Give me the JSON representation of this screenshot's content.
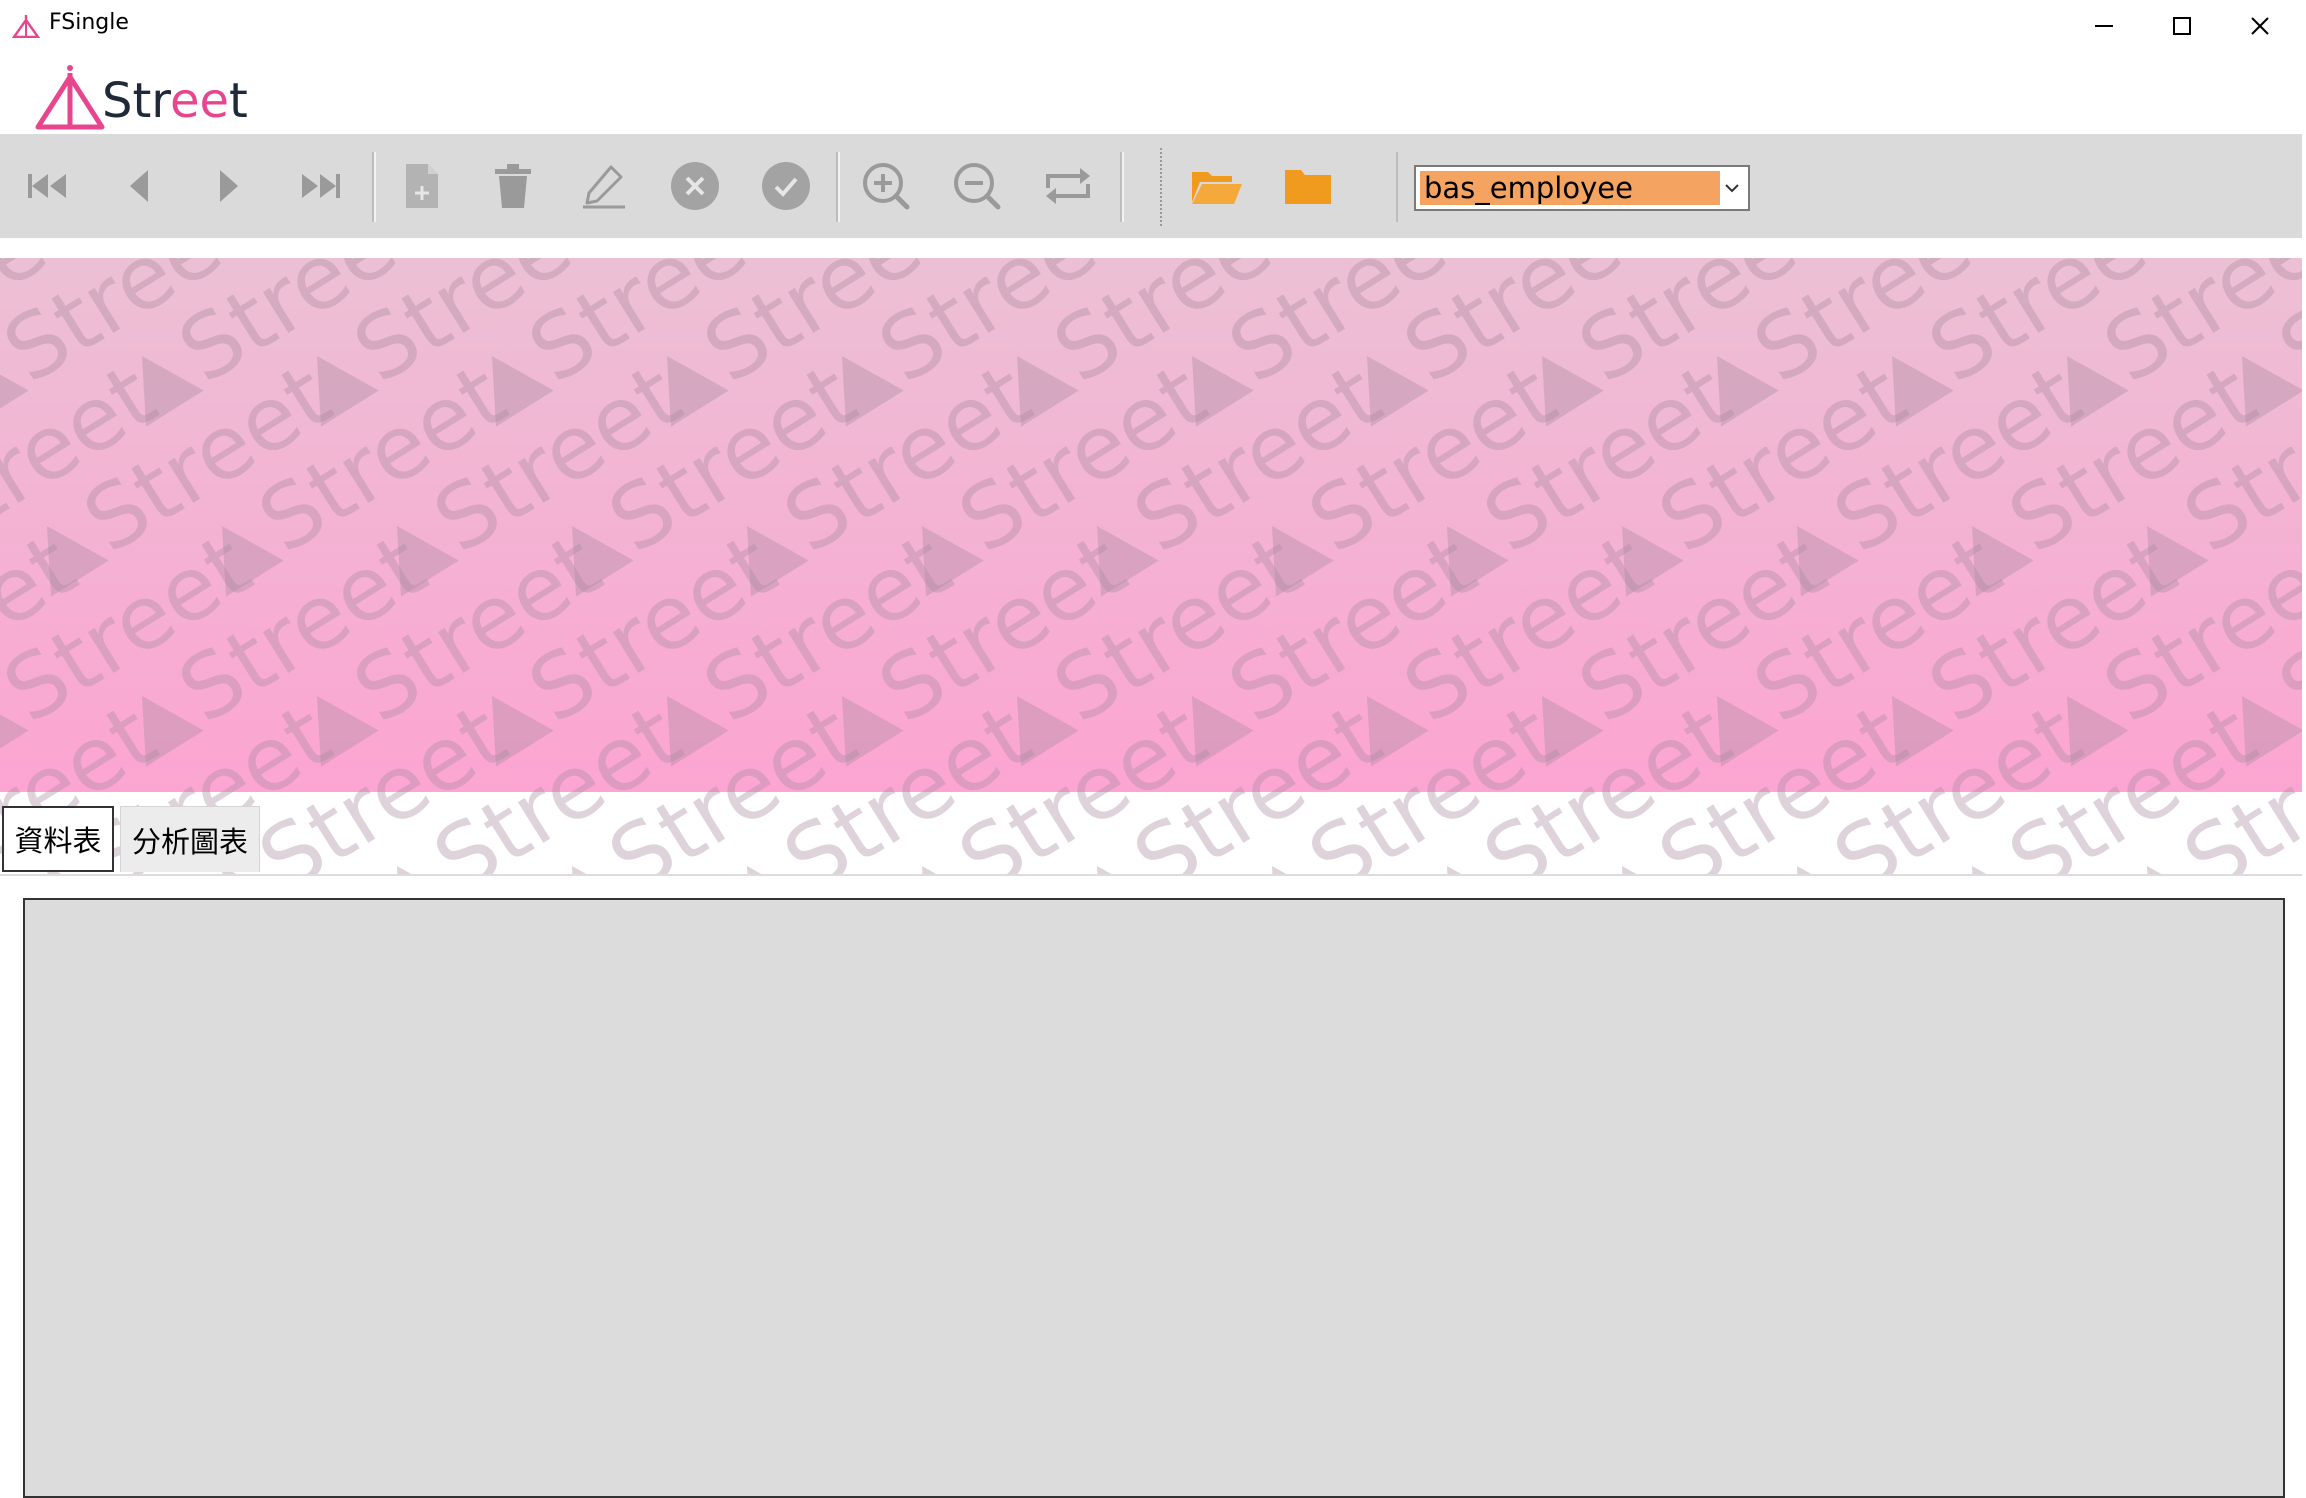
{
  "window": {
    "title": "FSingle",
    "controls": [
      "minimize-icon",
      "maximize-icon",
      "close-icon"
    ]
  },
  "logo": {
    "text_prefix": "Str",
    "text_accent": "ee",
    "text_suffix": "t",
    "accent_color": "#e8458f"
  },
  "toolbar": {
    "buttons": [
      {
        "name": "first-record-icon"
      },
      {
        "name": "previous-record-icon"
      },
      {
        "name": "next-record-icon"
      },
      {
        "name": "last-record-icon"
      },
      {
        "name": "new-record-icon"
      },
      {
        "name": "delete-record-icon"
      },
      {
        "name": "edit-record-icon"
      },
      {
        "name": "cancel-icon"
      },
      {
        "name": "confirm-icon"
      },
      {
        "name": "zoom-in-icon"
      },
      {
        "name": "zoom-out-icon"
      },
      {
        "name": "refresh-icon"
      },
      {
        "name": "open-folder-icon"
      },
      {
        "name": "folder-icon"
      }
    ],
    "table_select": {
      "value": "bas_employee",
      "highlight_color": "#f4a460"
    }
  },
  "banner": {
    "watermark_text": "Street",
    "gradient_top": "#ecc0d4",
    "gradient_bottom": "#fca5d2"
  },
  "tabs": [
    {
      "label": "資料表",
      "active": true
    },
    {
      "label": "分析圖表",
      "active": false
    }
  ]
}
